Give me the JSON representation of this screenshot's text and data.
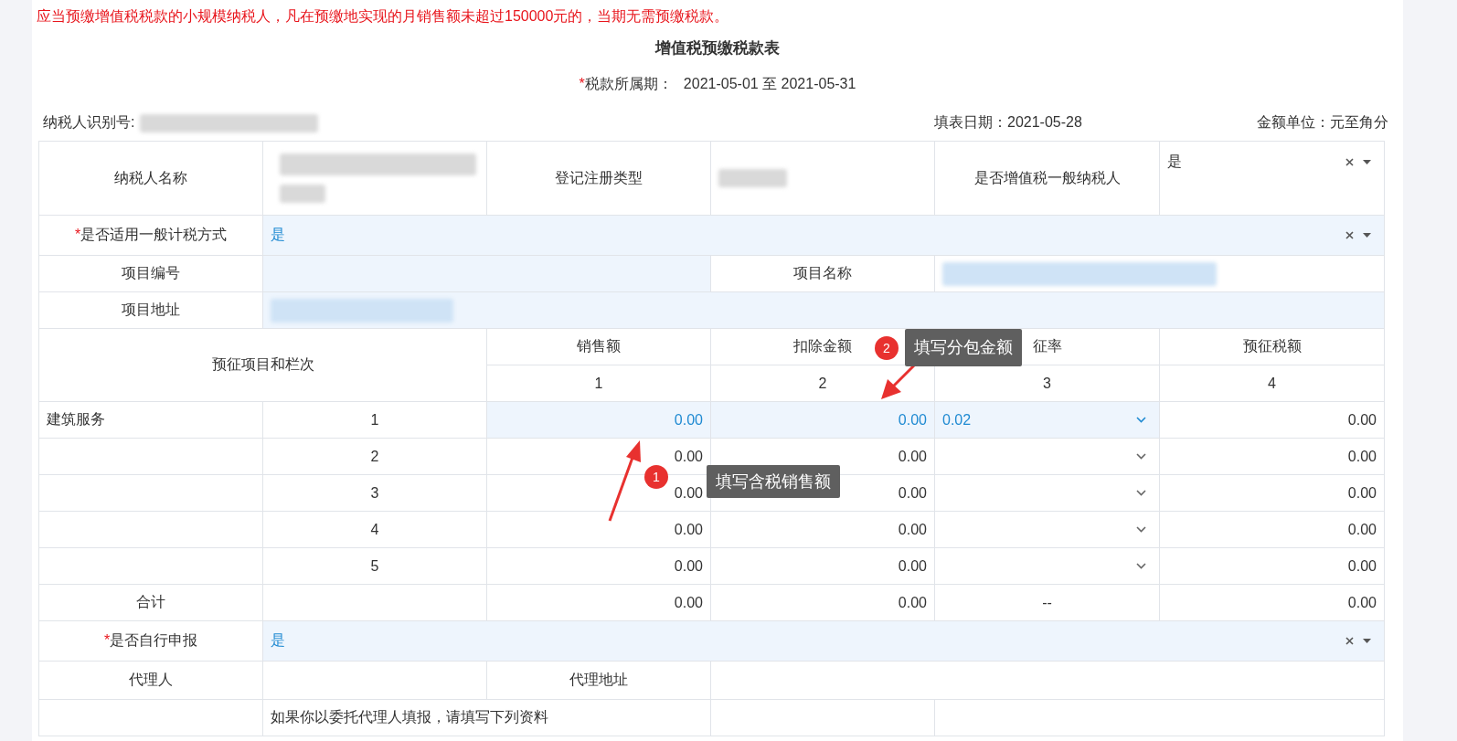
{
  "notice": "应当预缴增值税税款的小规模纳税人，凡在预缴地实现的月销售额未超过150000元的，当期无需预缴税款。",
  "form_title": "增值税预缴税款表",
  "period": {
    "required_mark": "*",
    "label": "税款所属期：",
    "value": "2021-05-01 至 2021-05-31"
  },
  "taxpayer_id": {
    "label": "纳税人识别号:"
  },
  "fill_date": "填表日期：2021-05-28",
  "unit": "金额单位：元至角分",
  "taxpayer_name": {
    "label": "纳税人名称"
  },
  "registration_type": {
    "label": "登记注册类型"
  },
  "general_taxpayer": {
    "label": "是否增值税一般纳税人",
    "value": "是"
  },
  "general_method": {
    "required_mark": "*",
    "label": "是否适用一般计税方式",
    "value": "是"
  },
  "project_no": {
    "label": "项目编号"
  },
  "project_name": {
    "label": "项目名称"
  },
  "project_address": {
    "label": "项目地址"
  },
  "levy": {
    "header_label": "预征项目和栏次",
    "columns": [
      {
        "name": "销售额",
        "index": "1"
      },
      {
        "name": "扣除金额",
        "index": "2"
      },
      {
        "name": "征率",
        "index": "3"
      },
      {
        "name": "预征税额",
        "index": "4"
      }
    ],
    "rows": [
      {
        "item": "建筑服务",
        "line": "1",
        "sales": "0.00",
        "deduction": "0.00",
        "rate": "0.02",
        "tax": "0.00",
        "selected": true
      },
      {
        "line": "2",
        "sales": "0.00",
        "deduction": "0.00",
        "tax": "0.00",
        "selected": false
      },
      {
        "line": "3",
        "sales": "0.00",
        "deduction": "0.00",
        "tax": "0.00",
        "selected": false
      },
      {
        "line": "4",
        "sales": "0.00",
        "deduction": "0.00",
        "tax": "0.00",
        "selected": false
      },
      {
        "line": "5",
        "sales": "0.00",
        "deduction": "0.00",
        "tax": "0.00",
        "selected": false
      }
    ]
  },
  "total": {
    "label": "合计",
    "sales": "0.00",
    "deduction": "0.00",
    "rate": "--",
    "tax": "0.00"
  },
  "self_filing": {
    "required_mark": "*",
    "label": "是否自行申报",
    "value": "是"
  },
  "agent": {
    "label": "代理人"
  },
  "agent_address": {
    "label": "代理地址"
  },
  "agent_note": "如果你以委托代理人填报，请填写下列资料",
  "callouts": [
    {
      "number": "1",
      "text": "填写含税销售额"
    },
    {
      "number": "2",
      "text": "填写分包金额"
    }
  ]
}
